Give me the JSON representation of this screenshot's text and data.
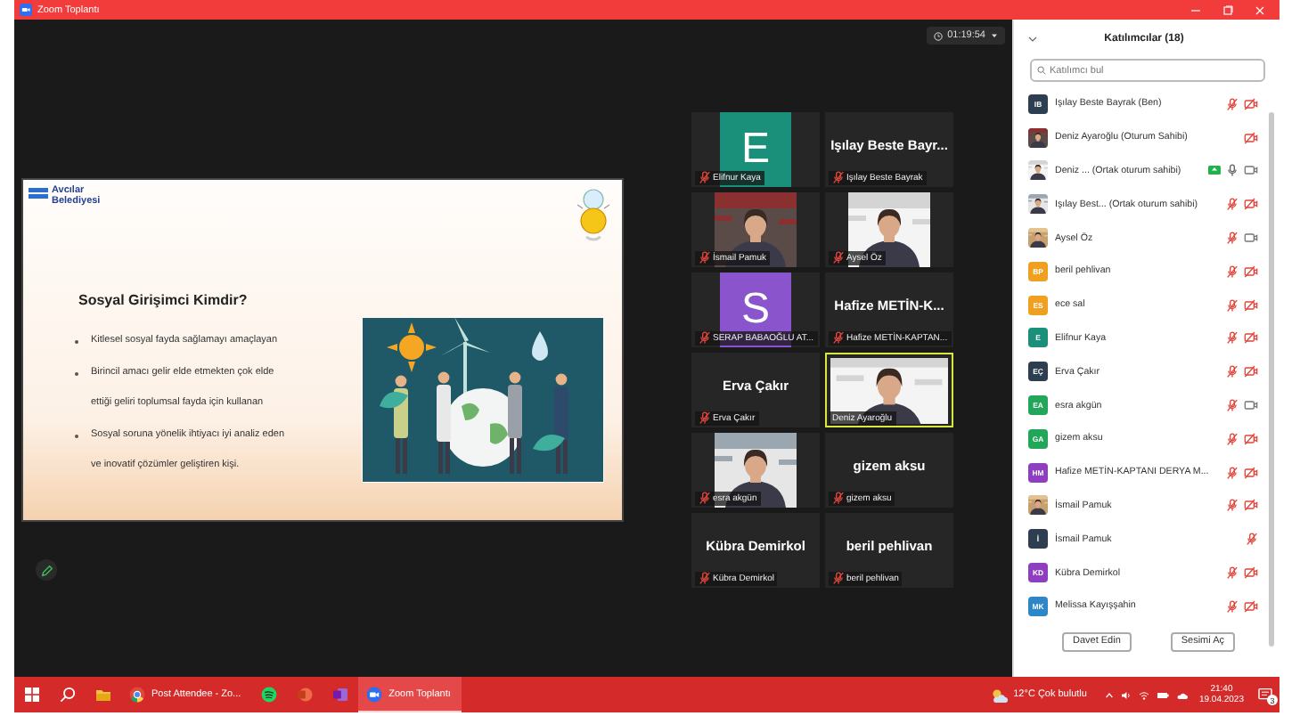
{
  "window": {
    "title": "Zoom Toplantı"
  },
  "meeting": {
    "timer": "01:19:54"
  },
  "slide": {
    "logo": [
      "Avcılar",
      "Belediyesi"
    ],
    "title": "Sosyal Girişimci Kimdir?",
    "bullets": [
      {
        "lines": [
          "Kitlesel sosyal fayda sağlamayı amaçlayan"
        ]
      },
      {
        "lines": [
          "Birincil amacı gelir elde etmekten çok elde",
          "ettiği geliri toplumsal fayda için kullanan"
        ]
      },
      {
        "lines": [
          "Sosyal soruna yönelik ihtiyacı iyi analiz eden",
          "ve inovatif çözümler geliştiren kişi."
        ]
      }
    ]
  },
  "tiles": [
    {
      "kind": "initial",
      "letter": "E",
      "color": "#1a8f7a",
      "label": "Elifnur Kaya",
      "muted": true,
      "speaking": false
    },
    {
      "kind": "name",
      "display": "Işılay  Beste  Bayr...",
      "label": "Işılay Beste Bayrak",
      "muted": true,
      "speaking": false
    },
    {
      "kind": "picture",
      "label": "İsmail Pamuk",
      "muted": true,
      "speaking": false
    },
    {
      "kind": "picture",
      "label": "Aysel Öz",
      "muted": true,
      "speaking": false
    },
    {
      "kind": "initial",
      "letter": "S",
      "color": "#8a55cc",
      "label": "SERAP BABAOĞLU AT...",
      "muted": true,
      "speaking": false
    },
    {
      "kind": "name",
      "display": "Hafize  METİN-K...",
      "label": "Hafize METİN-KAPTAN...",
      "muted": true,
      "speaking": false
    },
    {
      "kind": "name",
      "display": "Erva Çakır",
      "label": "Erva Çakır",
      "muted": true,
      "speaking": false
    },
    {
      "kind": "picture",
      "label": "Deniz Ayaroğlu",
      "muted": false,
      "speaking": true
    },
    {
      "kind": "picture",
      "label": "esra akgün",
      "muted": true,
      "speaking": false
    },
    {
      "kind": "name",
      "display": "gizem aksu",
      "label": "gizem aksu",
      "muted": true,
      "speaking": false
    },
    {
      "kind": "name",
      "display": "Kübra Demirkol",
      "label": "Kübra Demirkol",
      "muted": true,
      "speaking": false
    },
    {
      "kind": "name",
      "display": "beril pehlivan",
      "label": "beril pehlivan",
      "muted": true,
      "speaking": false
    }
  ],
  "participants": {
    "title": "Katılımcılar (18)",
    "search": {
      "placeholder": "Katılımcı bul"
    },
    "items": [
      {
        "name": "Işılay Beste Bayrak (Ben)",
        "avatar": {
          "kind": "initials",
          "initials": "IB",
          "color": "#2d3e50"
        },
        "screen_share": false,
        "mic": {
          "kind": "muted"
        },
        "camera": {
          "kind": "off"
        }
      },
      {
        "name": "Deniz Ayaroğlu (Oturum Sahibi)",
        "screen_share": false,
        "mic": {
          "kind": "none"
        },
        "camera": {
          "kind": "off"
        }
      },
      {
        "name": "Deniz ... (Ortak oturum sahibi)",
        "screen_share": true,
        "mic": {
          "kind": "on"
        },
        "camera": {
          "kind": "on"
        }
      },
      {
        "name": "Işılay Best... (Ortak oturum sahibi)",
        "screen_share": false,
        "mic": {
          "kind": "muted"
        },
        "camera": {
          "kind": "off"
        }
      },
      {
        "name": "Aysel Öz",
        "screen_share": false,
        "mic": {
          "kind": "muted"
        },
        "camera": {
          "kind": "on"
        }
      },
      {
        "name": "beril pehlivan",
        "avatar": {
          "kind": "initials",
          "initials": "BP",
          "color": "#f0a020"
        },
        "screen_share": false,
        "mic": {
          "kind": "muted"
        },
        "camera": {
          "kind": "off"
        }
      },
      {
        "name": "ece sal",
        "avatar": {
          "kind": "initials",
          "initials": "ES",
          "color": "#f0a020"
        },
        "screen_share": false,
        "mic": {
          "kind": "muted"
        },
        "camera": {
          "kind": "off"
        }
      },
      {
        "name": "Elifnur Kaya",
        "avatar": {
          "kind": "initials",
          "initials": "E",
          "color": "#1a8f7a"
        },
        "screen_share": false,
        "mic": {
          "kind": "muted"
        },
        "camera": {
          "kind": "off"
        }
      },
      {
        "name": "Erva Çakır",
        "avatar": {
          "kind": "initials",
          "initials": "EÇ",
          "color": "#2d3e50"
        },
        "screen_share": false,
        "mic": {
          "kind": "muted"
        },
        "camera": {
          "kind": "off"
        }
      },
      {
        "name": "esra akgün",
        "avatar": {
          "kind": "initials",
          "initials": "EA",
          "color": "#22a65a"
        },
        "screen_share": false,
        "mic": {
          "kind": "muted"
        },
        "camera": {
          "kind": "on"
        }
      },
      {
        "name": "gizem aksu",
        "avatar": {
          "kind": "initials",
          "initials": "GA",
          "color": "#22a65a"
        },
        "screen_share": false,
        "mic": {
          "kind": "muted"
        },
        "camera": {
          "kind": "off"
        }
      },
      {
        "name": "Hafize METİN-KAPTANI DERYA M...",
        "avatar": {
          "kind": "initials",
          "initials": "HM",
          "color": "#8e3fc0"
        },
        "screen_share": false,
        "mic": {
          "kind": "muted"
        },
        "camera": {
          "kind": "off"
        }
      },
      {
        "name": "İsmail Pamuk",
        "screen_share": false,
        "mic": {
          "kind": "muted"
        },
        "camera": {
          "kind": "off"
        }
      },
      {
        "name": "İsmail Pamuk",
        "avatar": {
          "kind": "initials",
          "initials": "İ",
          "color": "#2d3e50"
        },
        "screen_share": false,
        "mic": {
          "kind": "muted"
        },
        "camera": {
          "kind": "none"
        }
      },
      {
        "name": "Kübra Demirkol",
        "avatar": {
          "kind": "initials",
          "initials": "KD",
          "color": "#8e3fc0"
        },
        "screen_share": false,
        "mic": {
          "kind": "muted"
        },
        "camera": {
          "kind": "off"
        }
      },
      {
        "name": "Melissa Kayışşahin",
        "avatar": {
          "kind": "initials",
          "initials": "MK",
          "color": "#2d86c8"
        },
        "screen_share": false,
        "mic": {
          "kind": "muted"
        },
        "camera": {
          "kind": "off"
        }
      }
    ],
    "buttons": [
      "Davet Edin",
      "Sesimi Aç"
    ]
  },
  "taskbar": {
    "apps": [
      {
        "kind": "start",
        "selected": false
      },
      {
        "kind": "search",
        "selected": false
      },
      {
        "kind": "explorer",
        "selected": false
      },
      {
        "kind": "chrome",
        "label": "Post Attendee - Zo...",
        "selected": false
      },
      {
        "kind": "spotify",
        "selected": false
      },
      {
        "kind": "powerpoint",
        "selected": false
      },
      {
        "kind": "onenote",
        "selected": false
      },
      {
        "kind": "zoom",
        "label": "Zoom Toplantı",
        "selected": true
      }
    ],
    "weather": "12°C Çok bulutlu",
    "time": "21:40",
    "date": "19.04.2023",
    "notifications": "3"
  }
}
